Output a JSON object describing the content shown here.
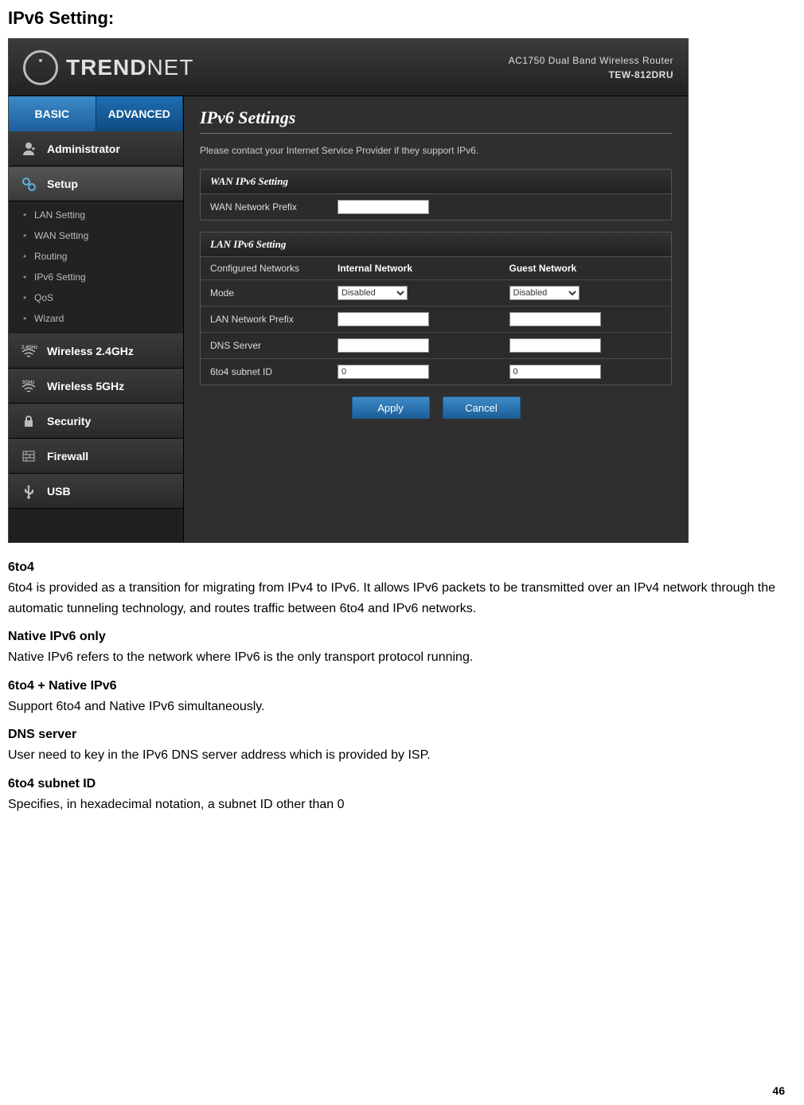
{
  "page_title": "IPv6 Setting:",
  "page_number": "46",
  "router": {
    "brand": "TRENDNET",
    "model_line1": "AC1750 Dual Band Wireless Router",
    "model_line2": "TEW-812DRU",
    "tabs": {
      "basic": "BASIC",
      "advanced": "ADVANCED"
    },
    "nav": {
      "admin": "Administrator",
      "setup": "Setup",
      "setup_sub": [
        "LAN Setting",
        "WAN Setting",
        "Routing",
        "IPv6 Setting",
        "QoS",
        "Wizard"
      ],
      "w24": "Wireless 2.4GHz",
      "w5": "Wireless 5GHz",
      "security": "Security",
      "firewall": "Firewall",
      "usb": "USB"
    },
    "panel": {
      "title": "IPv6 Settings",
      "note": "Please contact your Internet Service Provider if they support IPv6.",
      "wan_box_title": "WAN IPv6 Setting",
      "wan_prefix_label": "WAN Network Prefix",
      "lan_box_title": "LAN IPv6 Setting",
      "cfg_label": "Configured Networks",
      "col_internal": "Internal Network",
      "col_guest": "Guest Network",
      "row_mode": "Mode",
      "mode_value": "Disabled",
      "row_lan_prefix": "LAN Network Prefix",
      "row_dns": "DNS Server",
      "row_6to4": "6to4 subnet ID",
      "subnet_value": "0",
      "apply": "Apply",
      "cancel": "Cancel"
    }
  },
  "help": {
    "s1_h": "6to4",
    "s1_t": "6to4 is provided as a transition for migrating from IPv4 to IPv6. It allows IPv6 packets to be transmitted over an IPv4 network through the automatic tunneling technology, and routes traffic between 6to4 and IPv6 networks.",
    "s2_h": "Native IPv6 only",
    "s2_t": "Native IPv6 refers to the network where IPv6 is the only transport protocol running.",
    "s3_h": "6to4 + Native IPv6",
    "s3_t": "Support 6to4 and Native IPv6 simultaneously.",
    "s4_h": "DNS server",
    "s4_t": "User need to key in the IPv6 DNS server address which is provided by ISP.",
    "s5_h": "6to4 subnet ID",
    "s5_t": "Specifies, in hexadecimal notation, a subnet ID other than 0"
  }
}
